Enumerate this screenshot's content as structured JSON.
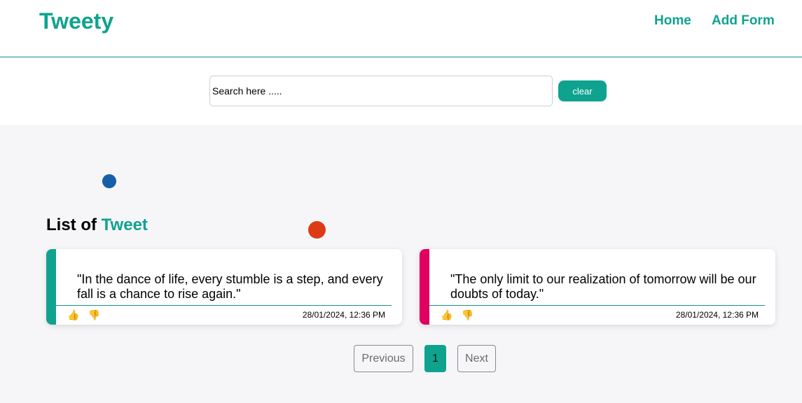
{
  "header": {
    "logo": "Tweety",
    "nav": {
      "home": "Home",
      "add_form": "Add Form"
    }
  },
  "search": {
    "placeholder": "Search here .....",
    "clear_label": "clear"
  },
  "list": {
    "title_prefix": "List of",
    "title_accent": "Tweet"
  },
  "tweets": [
    {
      "text": "\"In the dance of life, every stumble is a step, and every fall is a chance to rise again.\"",
      "timestamp": "28/01/2024, 12:36 PM",
      "like_icon": "👍",
      "dislike_icon": "👎",
      "accent_color": "#0fa38f"
    },
    {
      "text": "\"The only limit to our realization of tomorrow will be our doubts of today.\"",
      "timestamp": "28/01/2024, 12:36 PM",
      "like_icon": "👍",
      "dislike_icon": "👎",
      "accent_color": "#e0005f"
    }
  ],
  "pagination": {
    "previous": "Previous",
    "current": "1",
    "next": "Next"
  },
  "colors": {
    "brand": "#0fa38f",
    "dot_blue": "#1560a8",
    "dot_orange": "#dd3b14"
  }
}
